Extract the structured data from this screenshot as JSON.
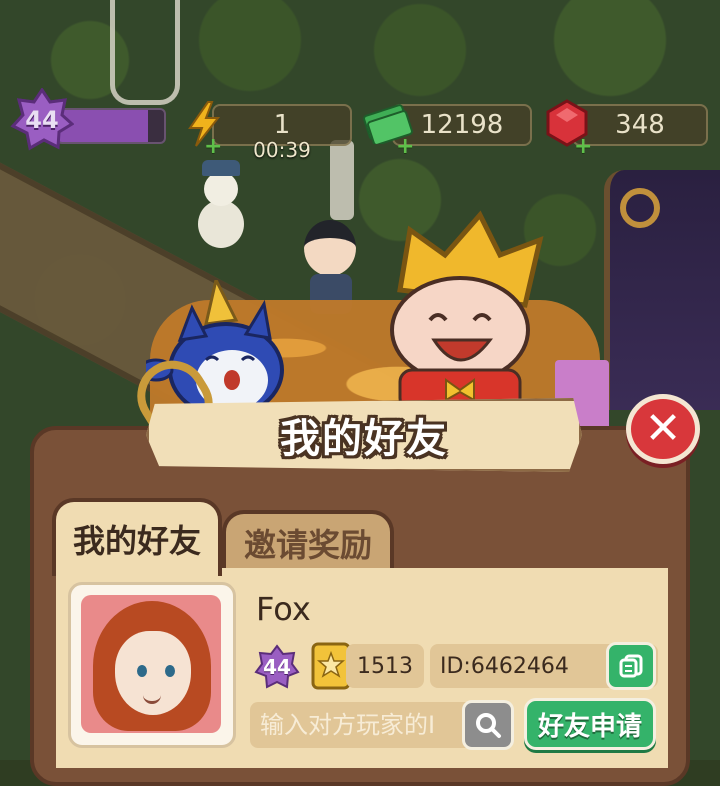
{
  "hud": {
    "level": "44",
    "level_progress": 0.85,
    "energy": "1",
    "energy_timer": "00:39",
    "cash": "12198",
    "gems": "348"
  },
  "dialog": {
    "title": "我的好友",
    "close_icon": "close-icon"
  },
  "tabs": [
    {
      "label": "我的好友",
      "active": true
    },
    {
      "label": "邀请奖励",
      "active": false
    }
  ],
  "friend": {
    "name": "Fox",
    "level": "44",
    "score": "1513",
    "id_text": "ID:6462464"
  },
  "search": {
    "placeholder": "输入对方玩家的ID",
    "apply_label": "好友申请"
  },
  "colors": {
    "panel": "#7a5138",
    "panel_inner": "#f0dcb2",
    "green_button": "#34b36a",
    "close_red": "#d8373b",
    "level_purple": "#8a4fb0"
  }
}
